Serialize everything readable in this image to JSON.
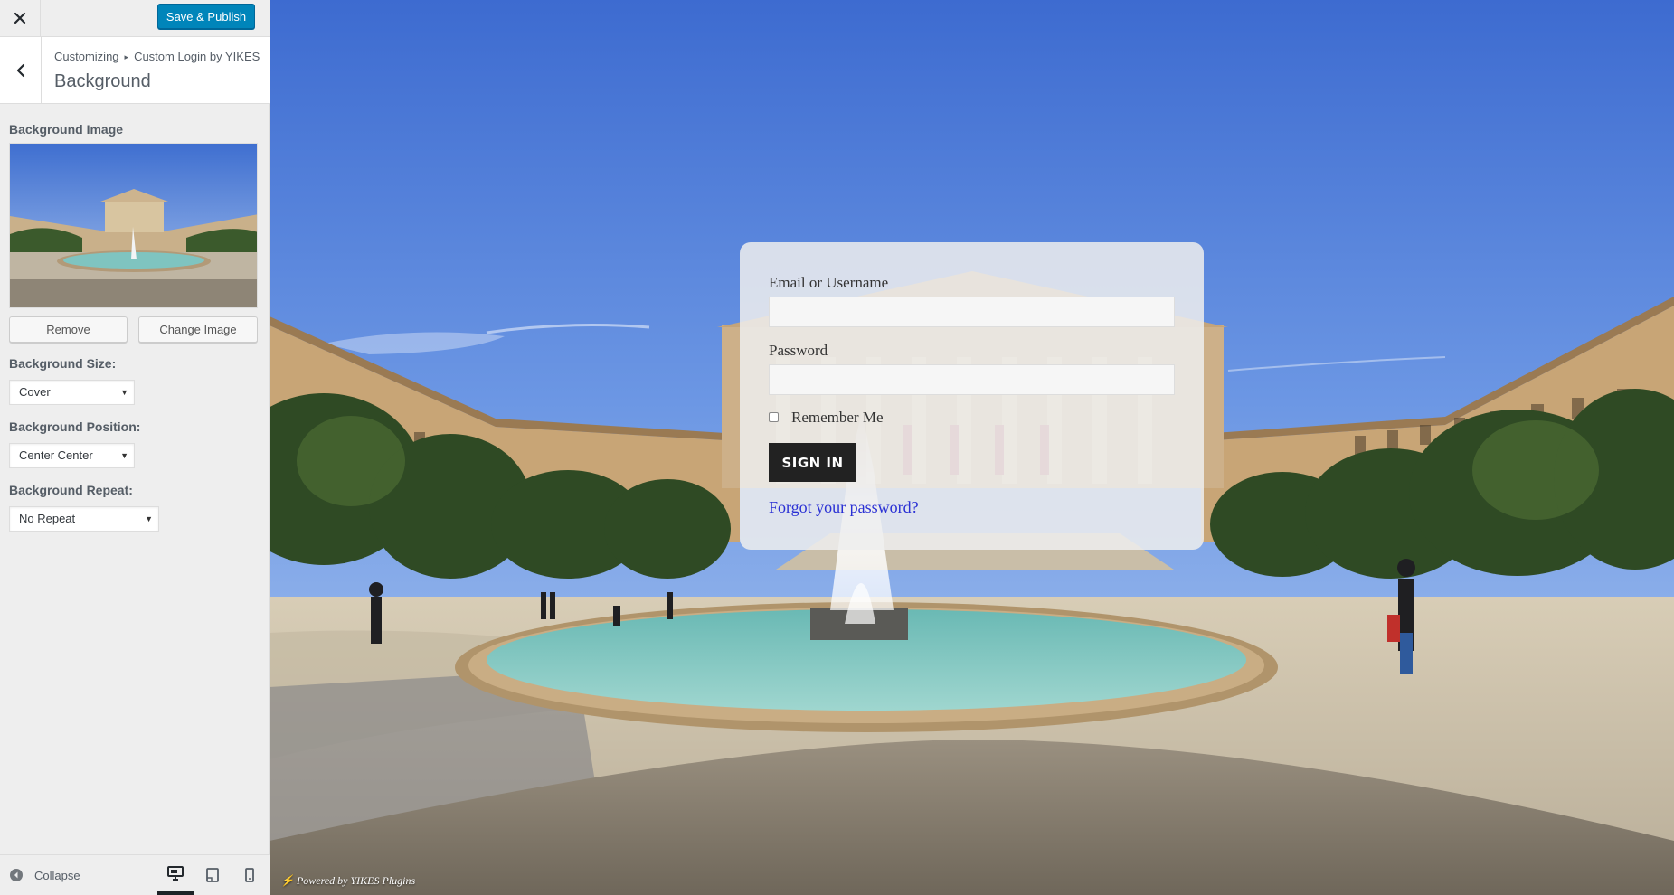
{
  "toolbar": {
    "close_icon": "close-icon",
    "save_label": "Save & Publish",
    "accent": "#0085ba"
  },
  "section": {
    "breadcrumb_root": "Customizing",
    "breadcrumb_current": "Custom Login by YIKES",
    "title": "Background"
  },
  "controls": {
    "background_image_label": "Background Image",
    "remove_label": "Remove",
    "change_image_label": "Change Image",
    "size_label": "Background Size:",
    "size_value": "Cover",
    "position_label": "Background Position:",
    "position_value": "Center Center",
    "repeat_label": "Background Repeat:",
    "repeat_value": "No Repeat"
  },
  "footer": {
    "collapse_label": "Collapse",
    "devices": [
      "desktop-icon",
      "tablet-icon",
      "mobile-icon"
    ],
    "active_device": "desktop"
  },
  "login": {
    "username_label": "Email or Username",
    "username_value": "",
    "password_label": "Password",
    "password_value": "",
    "remember_label": "Remember Me",
    "remember_checked": false,
    "signin_label": "SIGN IN",
    "forgot_label": "Forgot your password?"
  },
  "preview": {
    "powered_by": "Powered by YIKES Plugins",
    "sky_color": "#4a78d6",
    "fountain_water_color": "#7fc4c0"
  }
}
